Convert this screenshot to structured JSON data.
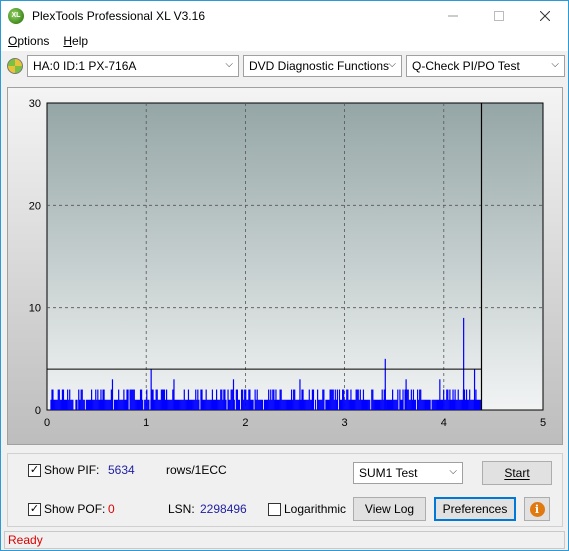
{
  "window": {
    "title": "PlexTools Professional XL V3.16",
    "icon_text": "XL"
  },
  "menu": [
    {
      "label": "Options",
      "accel": "O",
      "rest": "ptions"
    },
    {
      "label": "Help",
      "accel": "H",
      "rest": "elp"
    }
  ],
  "toolbar": {
    "drive": "HA:0 ID:1  PX-716A",
    "function": "DVD Diagnostic Functions",
    "test": "Q-Check PI/PO Test"
  },
  "chart_data": {
    "type": "bar",
    "x_ticks": [
      "0",
      "1",
      "2",
      "3",
      "4",
      "5"
    ],
    "y_ticks": [
      "0",
      "10",
      "20",
      "30"
    ],
    "xlim": [
      0,
      5
    ],
    "ylim": [
      0,
      30
    ],
    "threshold": 4,
    "scan_end_x": 4.38,
    "grid": true,
    "series_color": "#0000ff",
    "peaks": [
      {
        "x": 0.06,
        "y": 2
      },
      {
        "x": 0.32,
        "y": 2
      },
      {
        "x": 0.66,
        "y": 3
      },
      {
        "x": 1.05,
        "y": 4
      },
      {
        "x": 1.28,
        "y": 3
      },
      {
        "x": 1.88,
        "y": 3
      },
      {
        "x": 2.55,
        "y": 3
      },
      {
        "x": 3.41,
        "y": 5
      },
      {
        "x": 3.62,
        "y": 3
      },
      {
        "x": 3.96,
        "y": 3
      },
      {
        "x": 4.2,
        "y": 9
      },
      {
        "x": 4.31,
        "y": 4
      }
    ]
  },
  "controls": {
    "show_pif_label": "Show PIF:",
    "pif_value": "5634",
    "rows_label": "rows/1ECC",
    "test_select": "SUM1 Test",
    "start_label": "Start",
    "show_pof_label": "Show POF:",
    "pof_value": "0",
    "lsn_label": "LSN:",
    "lsn_value": "2298496",
    "log_label": "Logarithmic",
    "viewlog_label": "View Log",
    "prefs_label": "Preferences"
  },
  "status": {
    "text": "Ready"
  }
}
